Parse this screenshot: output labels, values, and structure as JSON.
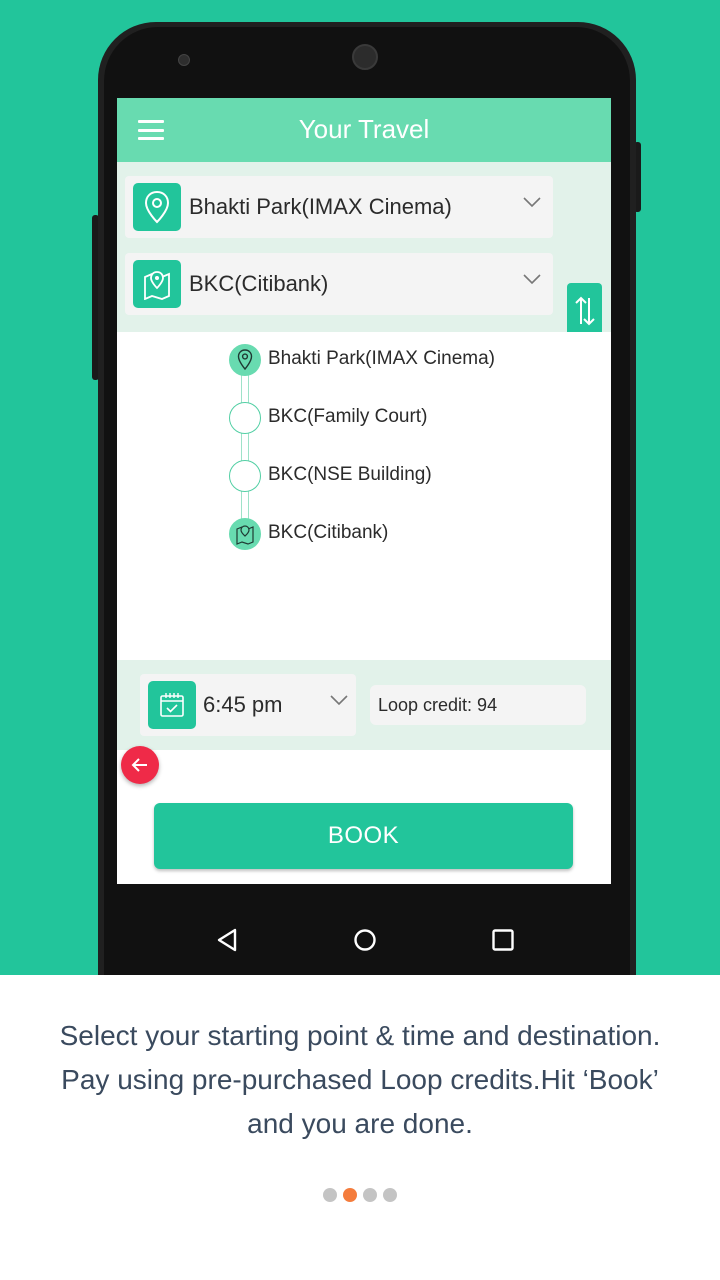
{
  "app": {
    "title": "Your Travel"
  },
  "route": {
    "from": "Bhakti Park(IMAX Cinema)",
    "to": "BKC(Citibank)"
  },
  "stops": [
    {
      "label": "Bhakti Park(IMAX Cinema)",
      "type": "origin"
    },
    {
      "label": "BKC(Family Court)",
      "type": "intermediate"
    },
    {
      "label": "BKC(NSE Building)",
      "type": "intermediate"
    },
    {
      "label": "BKC(Citibank)",
      "type": "destination"
    }
  ],
  "booking": {
    "time": "6:45 pm",
    "credit": "Loop credit: 94",
    "book_label": "BOOK"
  },
  "caption": {
    "line1": "Select your starting point & time and destination.",
    "line2": "Pay using pre-purchased Loop credits.Hit ‘Book’",
    "line3": "and you are done."
  },
  "pager": {
    "count": 4,
    "active_index": 1
  },
  "colors": {
    "brand_green": "#22c59b",
    "appbar_green": "#68dbb0",
    "panel_tint": "#e2f2ea",
    "back_red": "#ef2a48",
    "pager_active": "#f47c3c",
    "caption_text": "#3a4a5e"
  },
  "icons": {
    "menu": "hamburger-icon",
    "from": "map-pin-icon",
    "to": "map-icon",
    "swap": "swap-vertical-icon",
    "time": "calendar-icon",
    "back": "arrow-left-icon",
    "nav_back": "triangle-back-icon",
    "nav_home": "circle-home-icon",
    "nav_recents": "square-recents-icon"
  }
}
